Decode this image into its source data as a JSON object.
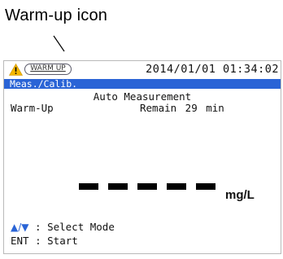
{
  "annotation": {
    "label": "Warm-up icon"
  },
  "status_bar": {
    "warning_icon": "warning-triangle-icon",
    "badge_text": "WARM UP",
    "datetime": "2014/01/01 01:34:02"
  },
  "title_bar": {
    "text": "Meas./Calib."
  },
  "main": {
    "mode": "Auto Measurement",
    "status_label": "Warm-Up",
    "remain_text": "Remain  29 min",
    "reading": "- - - - -",
    "unit": "mg/L"
  },
  "hints": {
    "select_keys": "▲/▼",
    "select_text": " : Select Mode",
    "start_text": "ENT : Start"
  },
  "colors": {
    "accent_blue": "#2a64d6",
    "warning_yellow": "#f5b800",
    "badge_border": "#5b5b6b"
  }
}
